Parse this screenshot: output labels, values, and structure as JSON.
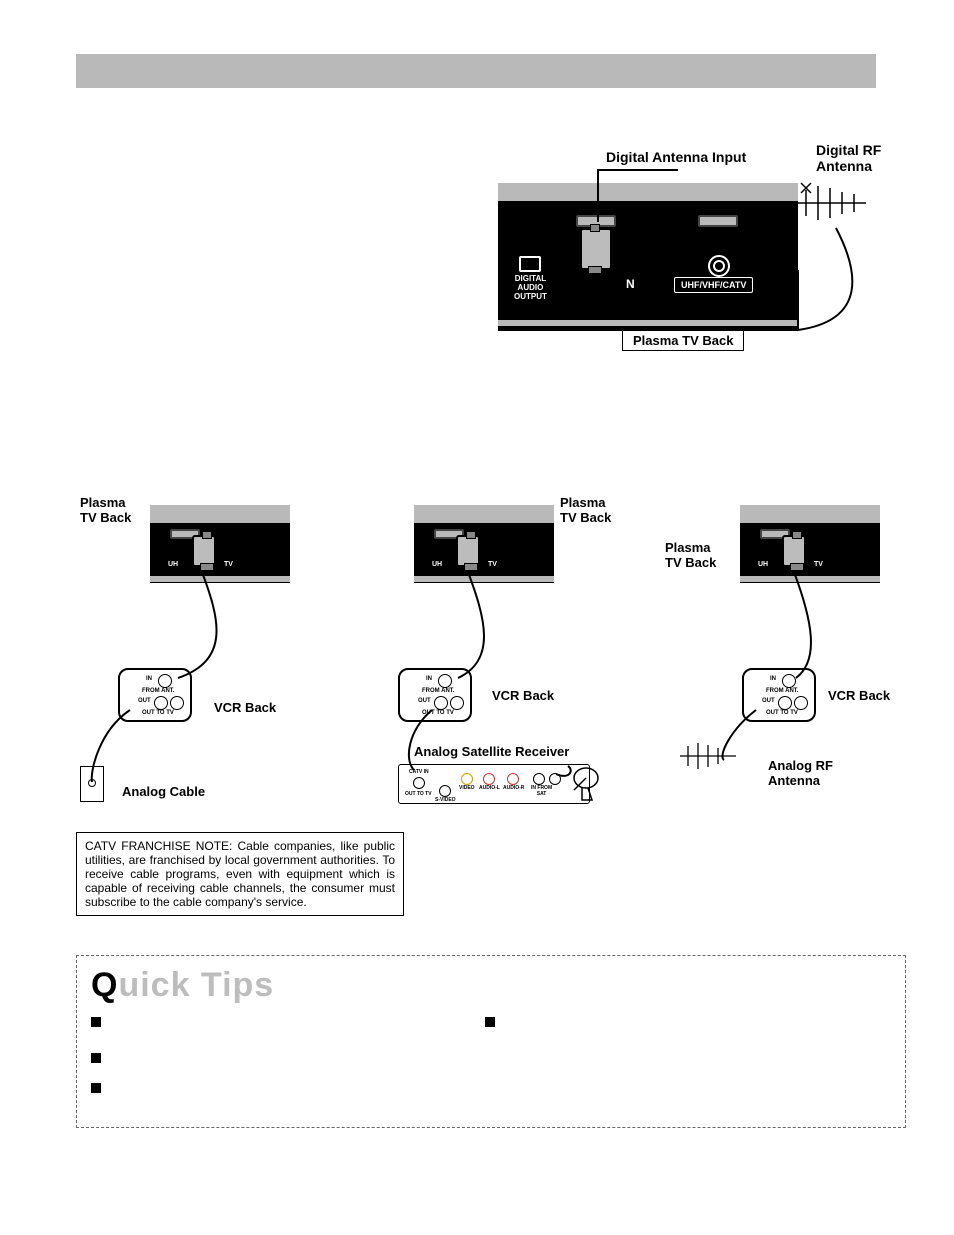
{
  "header": {
    "title_bar": ""
  },
  "fig1": {
    "digital_antenna_input": "Digital Antenna Input",
    "digital_rf_antenna_l1": "Digital RF",
    "digital_rf_antenna_l2": "Antenna",
    "plasma_tv_back": "Plasma TV Back",
    "digital_audio_output_l1": "DIGITAL",
    "digital_audio_output_l2": "AUDIO",
    "digital_audio_output_l3": "OUTPUT",
    "n_char": "N",
    "uhf_vhf_catv": "UHF/VHF/CATV"
  },
  "smallpanel": {
    "uh": "UH",
    "tv": "TV"
  },
  "vcr": {
    "in": "IN",
    "from_ant": "FROM ANT.",
    "out": "OUT",
    "out_to_tv": "OUT TO TV"
  },
  "figA": {
    "plasma_tv_back_l1": "Plasma",
    "plasma_tv_back_l2": "TV Back",
    "vcr_back": "VCR Back",
    "analog_cable": "Analog Cable"
  },
  "figB": {
    "plasma_tv_back_l1": "Plasma",
    "plasma_tv_back_l2": "TV Back",
    "vcr_back": "VCR Back",
    "analog_sat_receiver": "Analog Satellite Receiver"
  },
  "figC": {
    "plasma_tv_back_l1": "Plasma",
    "plasma_tv_back_l2": "TV Back",
    "vcr_back": "VCR Back",
    "analog_rf_antenna_l1": "Analog RF",
    "analog_rf_antenna_l2": "Antenna"
  },
  "sat": {
    "catv_in": "CATV IN",
    "out_to_tv": "OUT TO TV",
    "svideo": "S-VIDEO",
    "video": "VIDEO",
    "audio_l": "AUDIO-L",
    "audio_r": "AUDIO-R",
    "in_from_sat": "IN FROM\nSAT"
  },
  "note": {
    "text": "CATV FRANCHISE NOTE:  Cable companies, like public utilities, are franchised by local government authorities. To receive cable programs, even with equipment which is capable of receiving cable channels, the consumer must subscribe to the cable company's service."
  },
  "tips": {
    "heading_q": "Q",
    "heading_rest": "uick Tips"
  }
}
